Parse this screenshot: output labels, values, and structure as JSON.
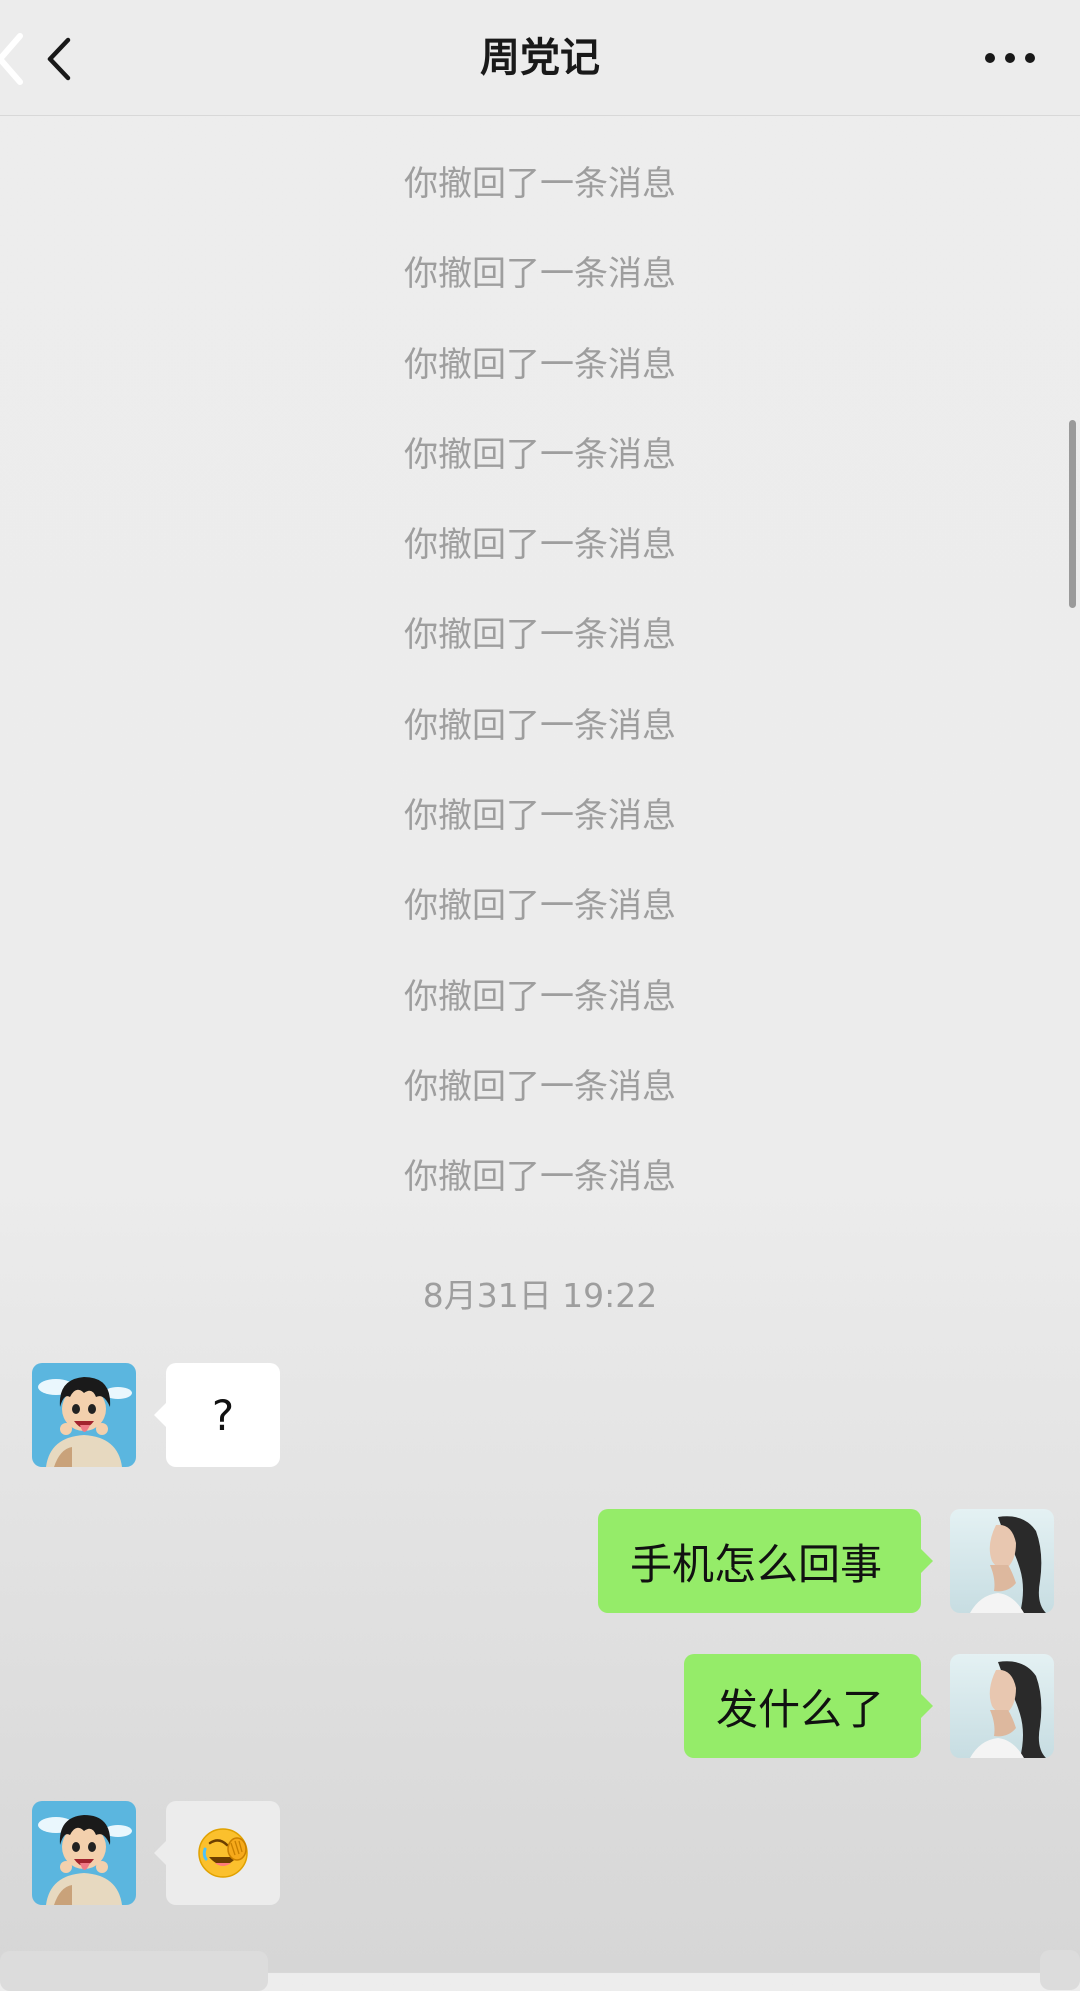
{
  "header": {
    "title": "周党记",
    "back_icon": "chevron-left-icon",
    "more_icon": "more-dots-icon"
  },
  "recall_notices": [
    "你撤回了一条消息",
    "你撤回了一条消息",
    "你撤回了一条消息",
    "你撤回了一条消息",
    "你撤回了一条消息",
    "你撤回了一条消息",
    "你撤回了一条消息",
    "你撤回了一条消息",
    "你撤回了一条消息",
    "你撤回了一条消息",
    "你撤回了一条消息",
    "你撤回了一条消息"
  ],
  "timestamp": "8月31日 19:22",
  "messages": [
    {
      "side": "in",
      "text": "?"
    },
    {
      "side": "out",
      "text": "手机怎么回事"
    },
    {
      "side": "out",
      "text": "发什么了"
    },
    {
      "side": "in",
      "emoji": "facepalm-laughing-emoji"
    }
  ],
  "colors": {
    "outgoing_bubble": "#95ec69",
    "incoming_bubble": "#ffffff",
    "system_text": "#9e9e9e",
    "background": "#ededed"
  }
}
